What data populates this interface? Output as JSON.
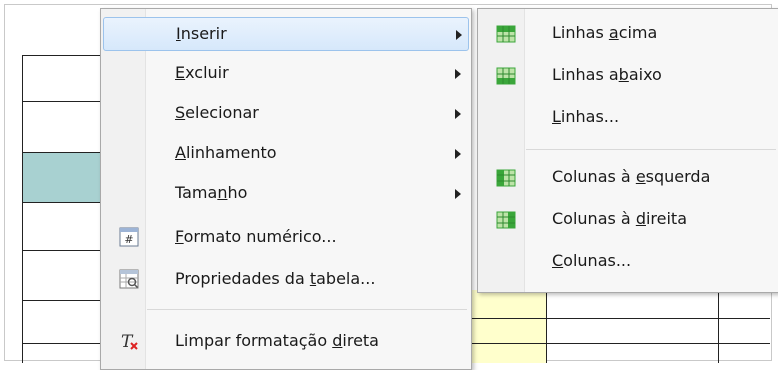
{
  "menu": {
    "items": [
      {
        "label": "Inserir",
        "has_submenu": true,
        "highlighted": true
      },
      {
        "label": "Excluir",
        "has_submenu": true
      },
      {
        "label": "Selecionar",
        "has_submenu": true
      },
      {
        "label": "Alinhamento",
        "has_submenu": true
      },
      {
        "label": "Tamanho",
        "has_submenu": true
      },
      {
        "label": "Formato numérico...",
        "icon": "number-format-icon"
      },
      {
        "label": "Propriedades da tabela...",
        "icon": "table-properties-icon"
      },
      {
        "label": "Limpar formatação direta",
        "icon": "clear-formatting-icon"
      }
    ]
  },
  "submenu": {
    "items": [
      {
        "label": "Linhas acima",
        "icon": "insert-rows-above-icon"
      },
      {
        "label": "Linhas abaixo",
        "icon": "insert-rows-below-icon"
      },
      {
        "label": "Linhas..."
      },
      {
        "label": "Colunas à esquerda",
        "icon": "insert-columns-left-icon"
      },
      {
        "label": "Colunas à direita",
        "icon": "insert-columns-right-icon"
      },
      {
        "label": "Colunas..."
      }
    ]
  },
  "colors": {
    "highlight": "#d6e8fb",
    "selected_cell": "#a8d1d1",
    "active_cell": "#ffffcc",
    "icon_green": "#3aa63a"
  }
}
